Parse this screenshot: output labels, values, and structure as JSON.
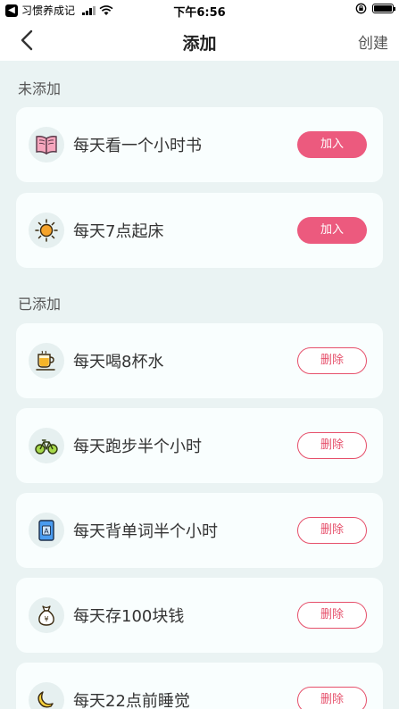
{
  "status_bar": {
    "back_app": "习惯养成记",
    "time": "下午6:56"
  },
  "nav": {
    "title": "添加",
    "right_action": "创建"
  },
  "sections": {
    "not_added": "未添加",
    "added": "已添加"
  },
  "not_added_items": [
    {
      "label": "每天看一个小时书",
      "icon": "book-icon",
      "button": "加入"
    },
    {
      "label": "每天7点起床",
      "icon": "sun-icon",
      "button": "加入"
    }
  ],
  "added_items": [
    {
      "label": "每天喝8杯水",
      "icon": "cup-icon",
      "button": "删除"
    },
    {
      "label": "每天跑步半个小时",
      "icon": "bike-icon",
      "button": "删除"
    },
    {
      "label": "每天背单词半个小时",
      "icon": "vocab-book-icon",
      "button": "删除"
    },
    {
      "label": "每天存100块钱",
      "icon": "money-bag-icon",
      "button": "删除"
    },
    {
      "label": "每天22点前睡觉",
      "icon": "moon-icon",
      "button": "删除"
    }
  ],
  "colors": {
    "accent": "#ec5a7e",
    "delete": "#e6506b",
    "background": "#eaf3f3"
  }
}
